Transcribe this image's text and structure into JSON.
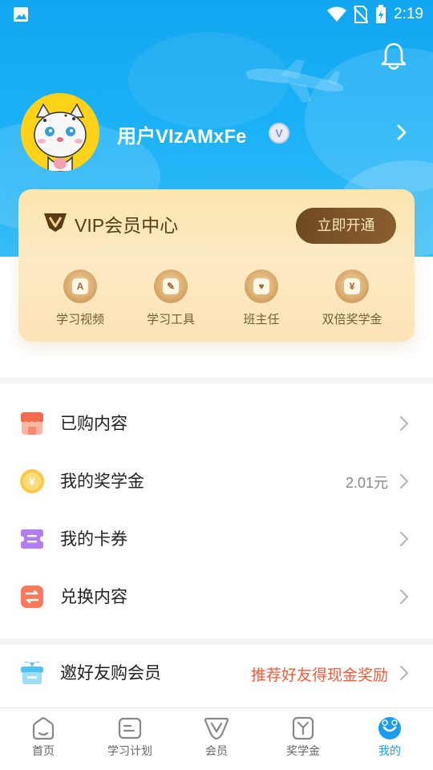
{
  "status_bar": {
    "time": "2:19"
  },
  "profile": {
    "username": "用户VIzAMxFe",
    "badge": "V"
  },
  "vip": {
    "logo": "V",
    "title": "VIP会员中心",
    "button_label": "立即开通",
    "features": [
      {
        "label": "学习视频",
        "glyph": "A"
      },
      {
        "label": "学习工具",
        "glyph": "✎"
      },
      {
        "label": "班主任",
        "glyph": "♥"
      },
      {
        "label": "双倍奖学金",
        "glyph": "¥"
      }
    ]
  },
  "menu": [
    {
      "label": "已购内容",
      "value": ""
    },
    {
      "label": "我的奖学金",
      "value": "2.01元"
    },
    {
      "label": "我的卡券",
      "value": ""
    },
    {
      "label": "兑换内容",
      "value": ""
    }
  ],
  "invite": {
    "label": "邀好友购会员",
    "highlight": "推荐好友得现金奖励"
  },
  "tabs": [
    {
      "label": "首页",
      "icon": "home-icon"
    },
    {
      "label": "学习计划",
      "icon": "plan-icon"
    },
    {
      "label": "会员",
      "icon": "vip-icon"
    },
    {
      "label": "奖学金",
      "icon": "scholarship-icon"
    },
    {
      "label": "我的",
      "icon": "profile-icon",
      "active": true
    }
  ],
  "colors": {
    "header_blue": "#1ab0f6",
    "accent_blue": "#1b9cf3",
    "vip_brown": "#6e4a22",
    "highlight_red": "#f25b3a"
  }
}
